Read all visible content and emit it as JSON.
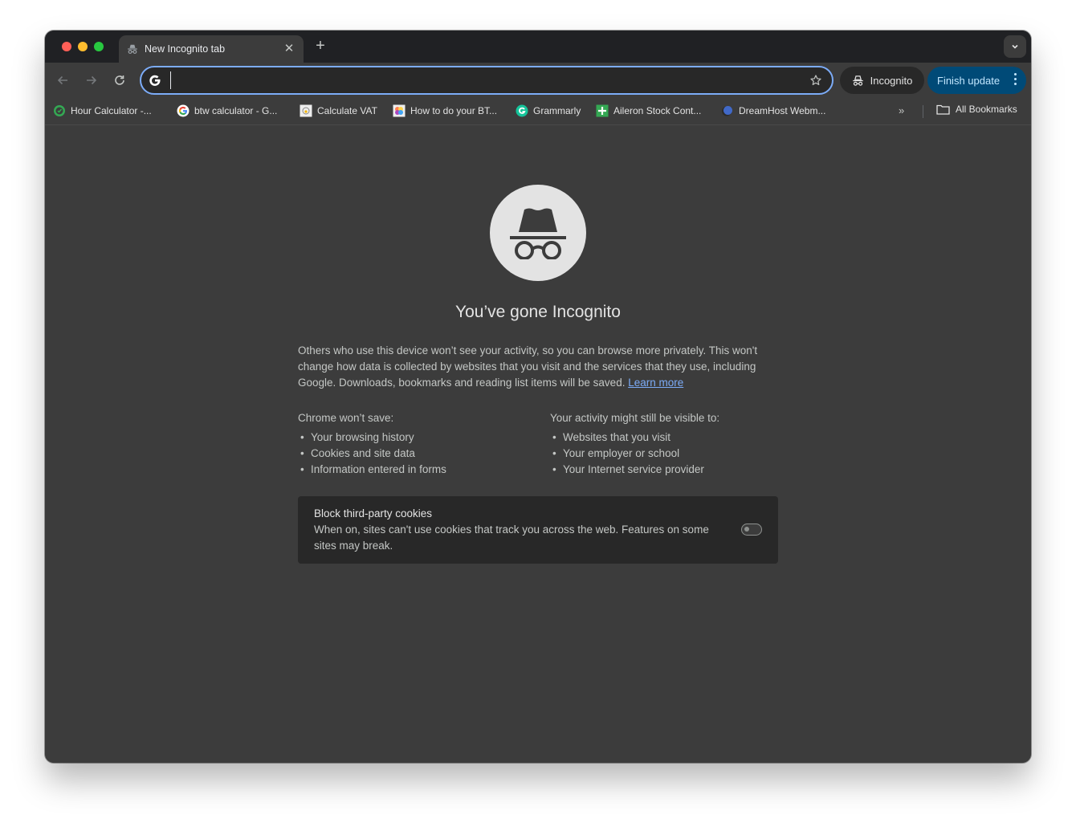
{
  "tab": {
    "title": "New Incognito tab",
    "icon": "incognito-icon",
    "close_icon": "close-icon"
  },
  "tabstrip": {
    "new_tab_icon": "plus-icon",
    "new_tab_label": "+",
    "tab_search_icon": "chevron-down-icon"
  },
  "toolbar": {
    "back_icon": "arrow-left-icon",
    "forward_icon": "arrow-right-icon",
    "reload_icon": "reload-icon",
    "omnibox": {
      "value": "",
      "search_engine_icon": "google-g-icon",
      "bookmark_icon": "star-icon"
    },
    "incognito_label": "Incognito",
    "finish_update_label": "Finish update",
    "menu_icon": "more-vert-icon"
  },
  "bookmarks": {
    "items": [
      {
        "label": "Hour Calculator -...",
        "icon": "green-clock-icon"
      },
      {
        "label": "btw calculator - G...",
        "icon": "google-icon"
      },
      {
        "label": "Calculate VAT",
        "icon": "vat-site-icon"
      },
      {
        "label": "How to do your BT...",
        "icon": "colorful-site-icon"
      },
      {
        "label": "Grammarly",
        "icon": "grammarly-icon"
      },
      {
        "label": "Aileron Stock Cont...",
        "icon": "green-sheet-icon"
      },
      {
        "label": "DreamHost Webm...",
        "icon": "dreamhost-icon"
      }
    ],
    "overflow_label": "»",
    "all_bookmarks_label": "All Bookmarks",
    "all_bookmarks_icon": "folder-icon"
  },
  "content": {
    "hero_icon": "incognito-icon",
    "headline": "You’ve gone Incognito",
    "description": "Others who use this device won’t see your activity, so you can browse more privately. This won't change how data is collected by websites that you visit and the services that they use, including Google. Downloads, bookmarks and reading list items will be saved. ",
    "learn_more": "Learn more",
    "wont_save": {
      "title": "Chrome won’t save:",
      "items": [
        "Your browsing history",
        "Cookies and site data",
        "Information entered in forms"
      ]
    },
    "still_visible": {
      "title": "Your activity might still be visible to:",
      "items": [
        "Websites that you visit",
        "Your employer or school",
        "Your Internet service provider"
      ]
    },
    "cookies": {
      "title": "Block third-party cookies",
      "description": "When on, sites can't use cookies that track you across the web. Features on some sites may break.",
      "enabled": false
    }
  },
  "colors": {
    "accent": "#7cacf8",
    "finish_update_bg": "#004a77",
    "page_bg": "#3c3c3c",
    "card_bg": "#282828"
  }
}
